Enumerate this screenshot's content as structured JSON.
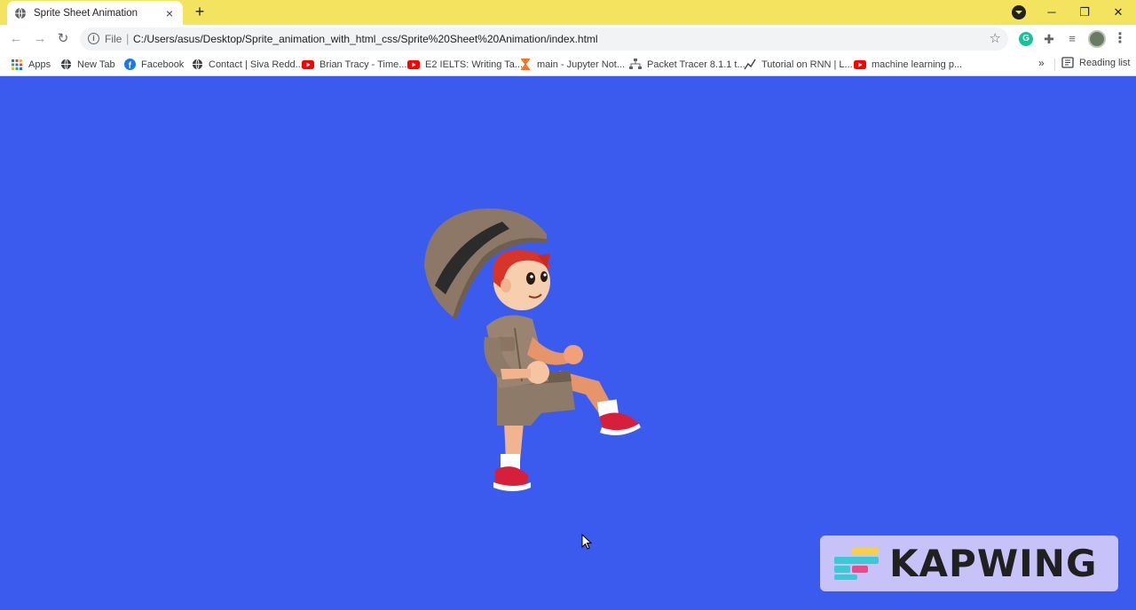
{
  "browser": {
    "tab": {
      "title": "Sprite Sheet Animation",
      "favicon": "globe-icon"
    },
    "new_tab_symbol": "+",
    "window_controls": {
      "minimize": "─",
      "restore": "❐",
      "close": "✕"
    },
    "toolbar": {
      "back": "←",
      "forward": "→",
      "reload": "↻",
      "scheme_label": "File",
      "url": "C:/Users/asus/Desktop/Sprite_animation_with_html_css/Sprite%20Sheet%20Animation/index.html",
      "bookmark_star": "☆",
      "menu": "⋮"
    },
    "bookmarks": [
      {
        "label": "Apps",
        "icon": "apps-grid-icon"
      },
      {
        "label": "New Tab",
        "icon": "globe-icon"
      },
      {
        "label": "Facebook",
        "icon": "facebook-icon"
      },
      {
        "label": "Contact | Siva Redd...",
        "icon": "globe-icon"
      },
      {
        "label": "Brian Tracy - Time...",
        "icon": "youtube-icon"
      },
      {
        "label": "E2 IELTS: Writing Ta...",
        "icon": "youtube-icon"
      },
      {
        "label": "main - Jupyter Not...",
        "icon": "hourglass-icon"
      },
      {
        "label": "Packet Tracer 8.1.1 t...",
        "icon": "network-icon"
      },
      {
        "label": "Tutorial on RNN | L...",
        "icon": "chart-line-icon"
      },
      {
        "label": "machine learning p...",
        "icon": "youtube-icon"
      }
    ],
    "more_bookmarks": "»",
    "reading_list": "Reading list"
  },
  "page": {
    "background": "#3b5bef",
    "sprite": "walking-boy-explorer"
  },
  "watermark": {
    "text": "KAPWING"
  }
}
